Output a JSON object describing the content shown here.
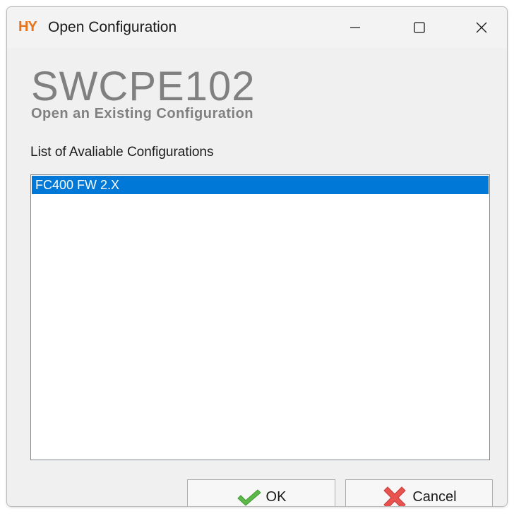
{
  "window": {
    "app_logo": "HY",
    "title": "Open Configuration",
    "controls": {
      "minimize_icon": "minimize-icon",
      "maximize_icon": "maximize-icon",
      "close_icon": "close-icon"
    }
  },
  "header": {
    "product_name": "SWCPE102",
    "subtitle": "Open an Existing Configuration"
  },
  "configurations": {
    "label": "List of Avaliable Configurations",
    "items": [
      {
        "label": "FC400 FW 2.X",
        "selected": true
      }
    ]
  },
  "buttons": {
    "ok_label": "OK",
    "ok_icon": "checkmark-icon",
    "cancel_label": "Cancel",
    "cancel_icon": "cross-icon"
  },
  "colors": {
    "logo": "#e8731a",
    "selection": "#0078d7",
    "heading_gray": "#808080",
    "ok_icon_green": "#5cb848",
    "cancel_icon_red": "#e8524f"
  }
}
